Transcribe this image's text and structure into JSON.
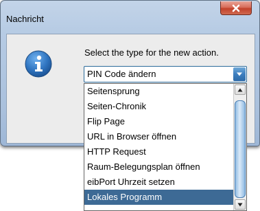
{
  "window": {
    "title": "Nachricht",
    "close_icon": "close-icon"
  },
  "dialog": {
    "icon": "info-icon",
    "prompt": "Select the type for the new action.",
    "combo": {
      "selected_value": "PIN Code ändern",
      "arrow_icon": "chevron-down-icon"
    },
    "dropdown": {
      "items": [
        "Seitensprung",
        "Seiten-Chronik",
        "Flip Page",
        "URL in Browser öffnen",
        "HTTP Request",
        "Raum-Belegungsplan öffnen",
        "eibPort Uhrzeit setzen",
        "Lokales Programm"
      ],
      "highlighted_item": "Lokales Programm",
      "highlight_color": "#3d6a95"
    }
  },
  "colors": {
    "title_bar": "#b6cbe4",
    "close_button": "#c2412a",
    "info_icon": "#2f74c0",
    "combo_arrow": "#3e7fbf"
  }
}
